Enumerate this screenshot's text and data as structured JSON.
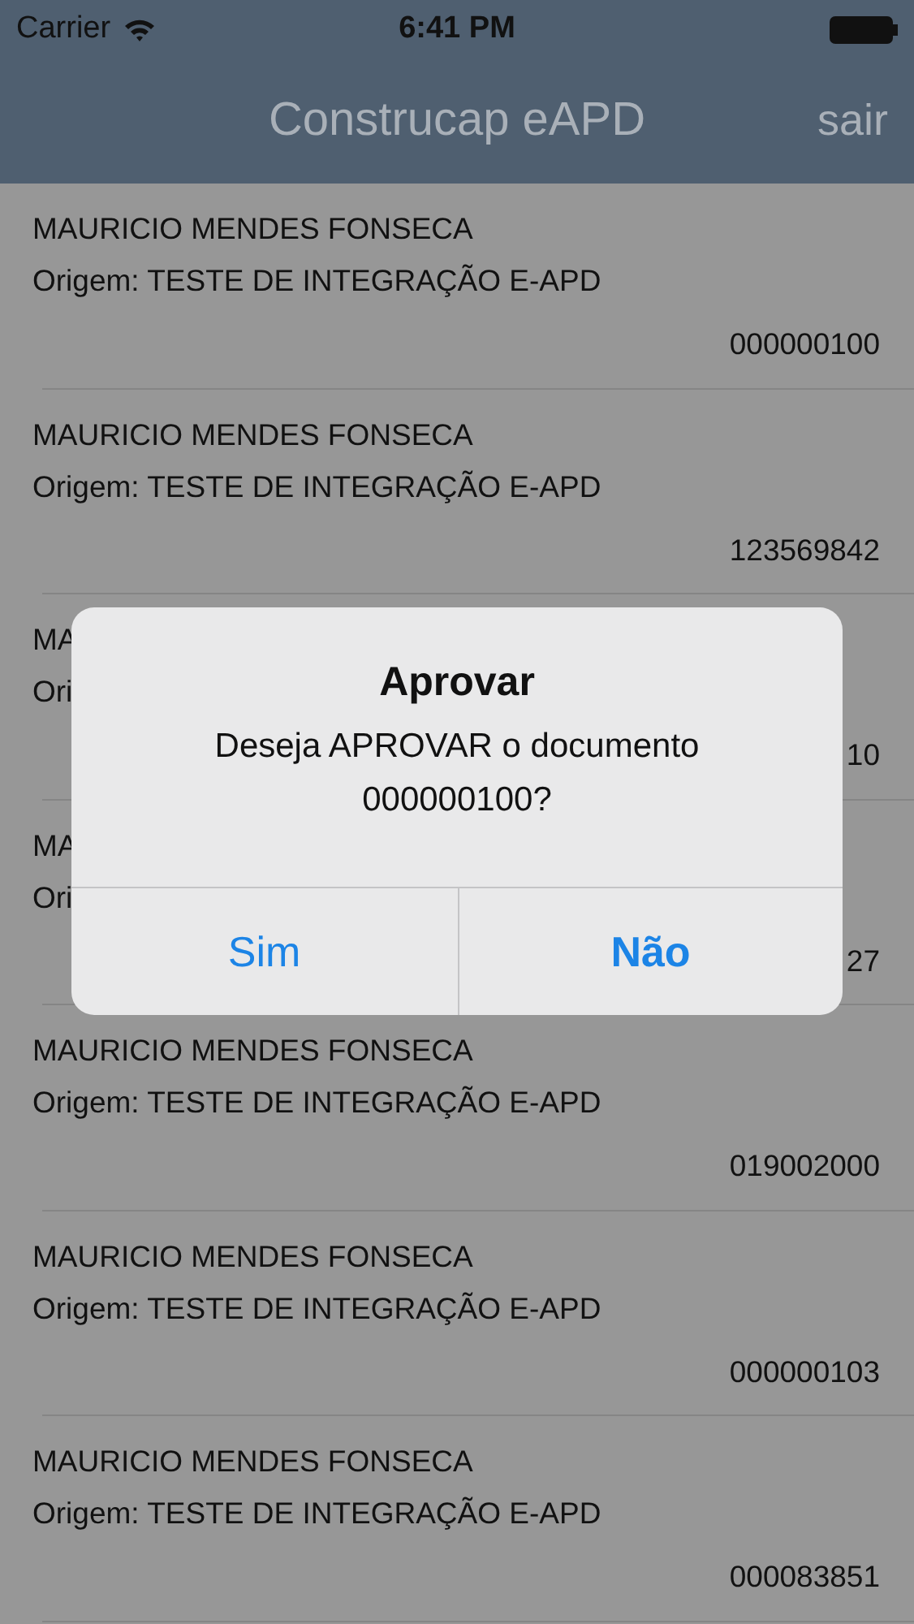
{
  "status_bar": {
    "carrier": "Carrier",
    "time": "6:41 PM"
  },
  "nav": {
    "title": "Construcap eAPD",
    "action": "sair"
  },
  "rows": [
    {
      "name": "MAURICIO MENDES FONSECA",
      "origin": "Origem: TESTE DE INTEGRAÇÃO E-APD",
      "number": "000000100"
    },
    {
      "name": "MAURICIO MENDES FONSECA",
      "origin": "Origem: TESTE DE INTEGRAÇÃO E-APD",
      "number": "123569842"
    },
    {
      "name": "MA",
      "origin": "Ori",
      "number": "10"
    },
    {
      "name": "MA",
      "origin": "Ori",
      "number": "27"
    },
    {
      "name": "MAURICIO MENDES FONSECA",
      "origin": "Origem: TESTE DE INTEGRAÇÃO E-APD",
      "number": "019002000"
    },
    {
      "name": "MAURICIO MENDES FONSECA",
      "origin": "Origem: TESTE DE INTEGRAÇÃO E-APD",
      "number": "000000103"
    },
    {
      "name": "MAURICIO MENDES FONSECA",
      "origin": "Origem: TESTE DE INTEGRAÇÃO E-APD",
      "number": "000083851"
    }
  ],
  "dialog": {
    "title": "Aprovar",
    "message": "Deseja APROVAR o documento 000000100?",
    "buttons": [
      {
        "label": "Sim",
        "primary": false
      },
      {
        "label": "Não",
        "primary": true
      }
    ]
  }
}
